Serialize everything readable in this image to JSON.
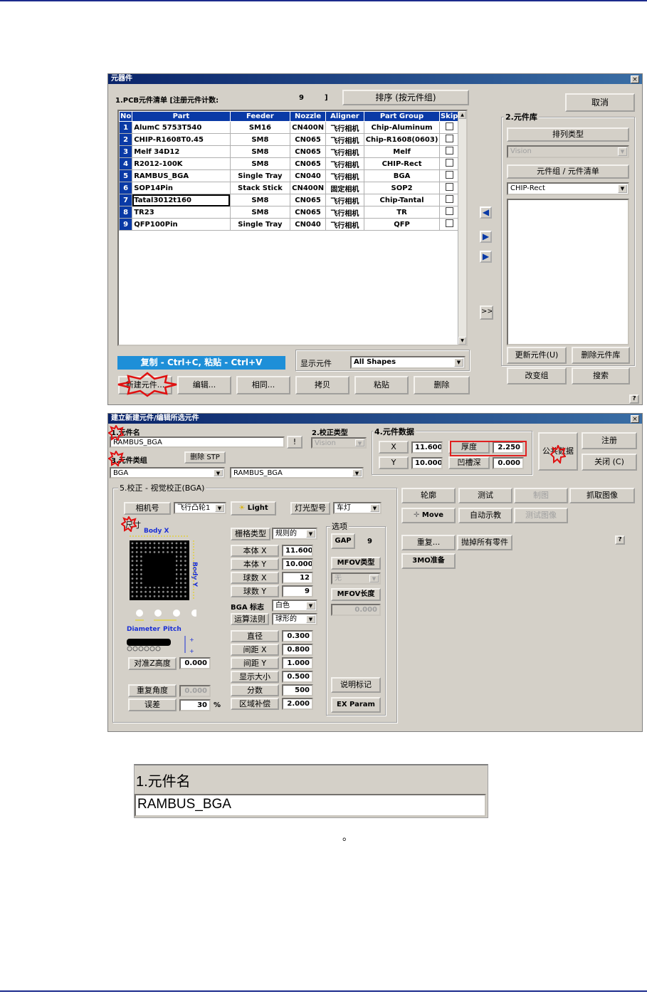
{
  "win1": {
    "title": "元器件",
    "close": "×",
    "list_header": "1.PCB元件清单 [注册元件计数:",
    "count": "9",
    "count_close": "]",
    "sort_button": "排序 (按元件组)",
    "columns": [
      "No",
      "Part",
      "Feeder",
      "Nozzle",
      "Aligner",
      "Part Group",
      "Skip"
    ],
    "rows": [
      {
        "no": "1",
        "part": "AlumC 5753T540",
        "feeder": "SM16",
        "nozzle": "CN400N",
        "aligner": "飞行相机",
        "group": "Chip-Aluminum"
      },
      {
        "no": "2",
        "part": "CHIP-R1608T0.45",
        "feeder": "SM8",
        "nozzle": "CN065",
        "aligner": "飞行相机",
        "group": "Chip-R1608(0603)"
      },
      {
        "no": "3",
        "part": "Melf 34D12",
        "feeder": "SM8",
        "nozzle": "CN065",
        "aligner": "飞行相机",
        "group": "Melf"
      },
      {
        "no": "4",
        "part": "R2012-100K",
        "feeder": "SM8",
        "nozzle": "CN065",
        "aligner": "飞行相机",
        "group": "CHIP-Rect"
      },
      {
        "no": "5",
        "part": "RAMBUS_BGA",
        "feeder": "Single Tray",
        "nozzle": "CN040",
        "aligner": "飞行相机",
        "group": "BGA"
      },
      {
        "no": "6",
        "part": "SOP14Pin",
        "feeder": "Stack Stick",
        "nozzle": "CN400N",
        "aligner": "固定相机",
        "group": "SOP2"
      },
      {
        "no": "7",
        "part": "Tatal3012t160",
        "feeder": "SM8",
        "nozzle": "CN065",
        "aligner": "飞行相机",
        "group": "Chip-Tantal"
      },
      {
        "no": "8",
        "part": "TR23",
        "feeder": "SM8",
        "nozzle": "CN065",
        "aligner": "飞行相机",
        "group": "TR"
      },
      {
        "no": "9",
        "part": "QFP100Pin",
        "feeder": "Single Tray",
        "nozzle": "CN040",
        "aligner": "飞行相机",
        "group": "QFP"
      }
    ],
    "copy_hint": "复制 - Ctrl+C, 粘贴 - Ctrl+V",
    "show_label": "显示元件",
    "show_value": "All Shapes",
    "buttons": [
      "新建元件...",
      "编辑...",
      "相同...",
      "拷贝",
      "粘贴",
      "删除"
    ],
    "cancel": "取消",
    "lib_title": "2.元件库",
    "sort_type": "排列类型",
    "sort_value": "Vision",
    "group_list_label": "元件组 / 元件清单",
    "group_value": "CHIP-Rect",
    "update_button": "更新元件(U)",
    "delete_lib_button": "删除元件库",
    "change_group_button": "改变组",
    "search_button": "搜索",
    "move_all": ">>",
    "help": "?"
  },
  "win2": {
    "title": "建立新建元件/编辑所选元件",
    "close": "×",
    "name_label": "1.元件名",
    "name_value": "RAMBUS_BGA",
    "name_btn": "!",
    "type_label": "3.元件类组",
    "delete_stp": "删除 STP",
    "type_value": "BGA",
    "type_value2": "RAMBUS_BGA",
    "align_label": "2.校正类型",
    "align_value": "Vision",
    "data_label": "4.元件数据",
    "x_label": "X",
    "x_value": "11.600",
    "y_label": "Y",
    "y_value": "10.000",
    "thick_label": "厚度",
    "thick_value": "2.250",
    "concave_label": "凹槽深",
    "concave_value": "0.000",
    "common_data": "公共数据",
    "register": "注册",
    "close_btn": "关闭 (C)",
    "section5": "5.校正 - 视觉校正(BGA)",
    "camera_label": "相机号",
    "camera_value": "飞行凸轮1",
    "light_btn": "Light",
    "light_type_label": "灯光型号",
    "light_type_value": "车灯",
    "size_label": "尺寸",
    "body_x": "Body X",
    "body_y": "Body Y",
    "diameter": "Diameter",
    "pitch": "Pitch",
    "grid_type_label": "栅格类型",
    "grid_type_value": "规则的",
    "fields": [
      {
        "label": "本体 X",
        "value": "11.600"
      },
      {
        "label": "本体 Y",
        "value": "10.000"
      },
      {
        "label": "球数 X",
        "value": "12"
      },
      {
        "label": "球数 Y",
        "value": "9"
      }
    ],
    "bga_mark_label": "BGA 标志",
    "bga_mark_value": "白色",
    "algo_label": "运算法则",
    "algo_value": "球形的",
    "fields2": [
      {
        "label": "直径",
        "value": "0.300"
      },
      {
        "label": "间距 X",
        "value": "0.800"
      },
      {
        "label": "间距 Y",
        "value": "1.000"
      },
      {
        "label": "显示大小",
        "value": "0.500"
      },
      {
        "label": "分数",
        "value": "500"
      },
      {
        "label": "区域补偿",
        "value": "2.000"
      }
    ],
    "z_label": "对准Z高度",
    "z_value": "0.000",
    "repeat_angle_label": "重复角度",
    "repeat_angle_value": "0.000",
    "err_label": "误差",
    "err_value": "30",
    "err_unit": "%",
    "options_label": "选项",
    "gap_btn": "GAP",
    "gap_value": "9",
    "mfov_type": "MFOV类型",
    "mfov_type_value": "无",
    "mfov_len": "MFOV长度",
    "mfov_len_value": "0.000",
    "note_btn": "说明标记",
    "ex_btn": "EX Param",
    "right_btns": [
      "轮廓",
      "测试",
      "制图",
      "抓取图像"
    ],
    "move_btn": "Move",
    "auto_btn": "自动示教",
    "test_img_btn": "测试图像",
    "repeat_btn": "重复...",
    "throw_btn": "抛掉所有零件",
    "prep_btn": "3MO准备",
    "help": "?"
  },
  "zoom": {
    "label": "1.元件名",
    "value": "RAMBUS_BGA"
  },
  "caption": "。"
}
